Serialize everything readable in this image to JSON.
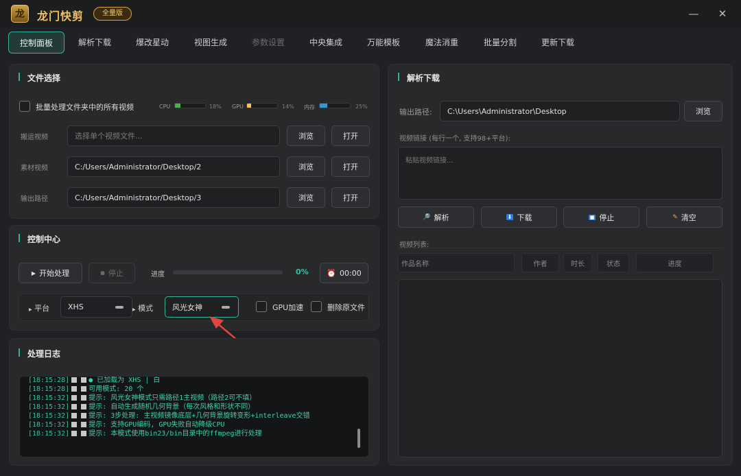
{
  "app": {
    "logo_glyph": "龙",
    "title": "龙门快剪",
    "edition": "全量版",
    "minimize": "—",
    "close": "✕"
  },
  "tabs": [
    {
      "label": "控制面板",
      "active": true
    },
    {
      "label": "解析下载"
    },
    {
      "label": "爆改星动"
    },
    {
      "label": "视图生成"
    },
    {
      "label": "参数设置",
      "disabled": true
    },
    {
      "label": "中央集成"
    },
    {
      "label": "万能模板"
    },
    {
      "label": "魔法消重"
    },
    {
      "label": "批量分割"
    },
    {
      "label": "更新下载"
    }
  ],
  "file_select": {
    "title": "文件选择",
    "batch_label": "批量处理文件夹中的所有视频",
    "meters": [
      {
        "name": "CPU",
        "pct": "18%",
        "value": 0.18,
        "color": "#4caf50"
      },
      {
        "name": "GPU",
        "pct": "14%",
        "value": 0.14,
        "color": "#f3c64a"
      },
      {
        "name": "内存",
        "pct": "25%",
        "value": 0.25,
        "color": "#2d9cdb"
      }
    ],
    "rows": [
      {
        "label": "搬运视频",
        "value": "",
        "placeholder": "选择单个视频文件..."
      },
      {
        "label": "素材视频",
        "value": "C:/Users/Administrator/Desktop/2"
      },
      {
        "label": "输出路径",
        "value": "C:/Users/Administrator/Desktop/3"
      }
    ],
    "browse": "浏览",
    "open": "打开"
  },
  "control": {
    "title": "控制中心",
    "start": "开始处理",
    "stop": "停止",
    "progress_label": "进度",
    "progress_pct": "0%",
    "progress_value": 0,
    "time": "00:00",
    "platform_label": "平台",
    "platform_value": "XHS",
    "mode_label": "模式",
    "mode_value": "风光女神",
    "gpu_label": "GPU加速",
    "delete_label": "删除原文件"
  },
  "log": {
    "title": "处理日志",
    "lines": [
      {
        "ts": "[18:15:28]",
        "msg": "● 已加载为 XHS | 白"
      },
      {
        "ts": "[18:15:28]",
        "msg": "可用模式: 20 个"
      },
      {
        "ts": "[18:15:32]",
        "msg": "提示: 风光女神模式只需路径1主视频（路径2可不填）"
      },
      {
        "ts": "[18:15:32]",
        "msg": "提示: 自动生成随机几何背景（每次风格和形状不同）"
      },
      {
        "ts": "[18:15:32]",
        "msg": "提示: 3步处理: 主视频镜像底层+几何背景旋转变形+interleave交错"
      },
      {
        "ts": "[18:15:32]",
        "msg": "提示: 支持GPU编码, GPU失败自动降级CPU"
      },
      {
        "ts": "[18:15:32]",
        "msg": "提示: 本模式使用bin23/bin目录中的ffmpeg进行处理"
      }
    ]
  },
  "download": {
    "title": "解析下载",
    "output_label": "输出路径:",
    "output_value": "C:\\Users\\Administrator\\Desktop",
    "browse": "浏览",
    "link_label": "视频链接 (每行一个, 支持98+平台):",
    "link_placeholder": "粘贴视频链接...",
    "actions": [
      {
        "label": "解析",
        "icon": "🔎"
      },
      {
        "label": "下载",
        "icon": "⬇"
      },
      {
        "label": "停止",
        "icon": "■"
      },
      {
        "label": "清空",
        "icon": "✎"
      }
    ],
    "list_label": "视频列表:",
    "columns": [
      "作品名称",
      "作者",
      "时长",
      "状态",
      "进度"
    ]
  }
}
